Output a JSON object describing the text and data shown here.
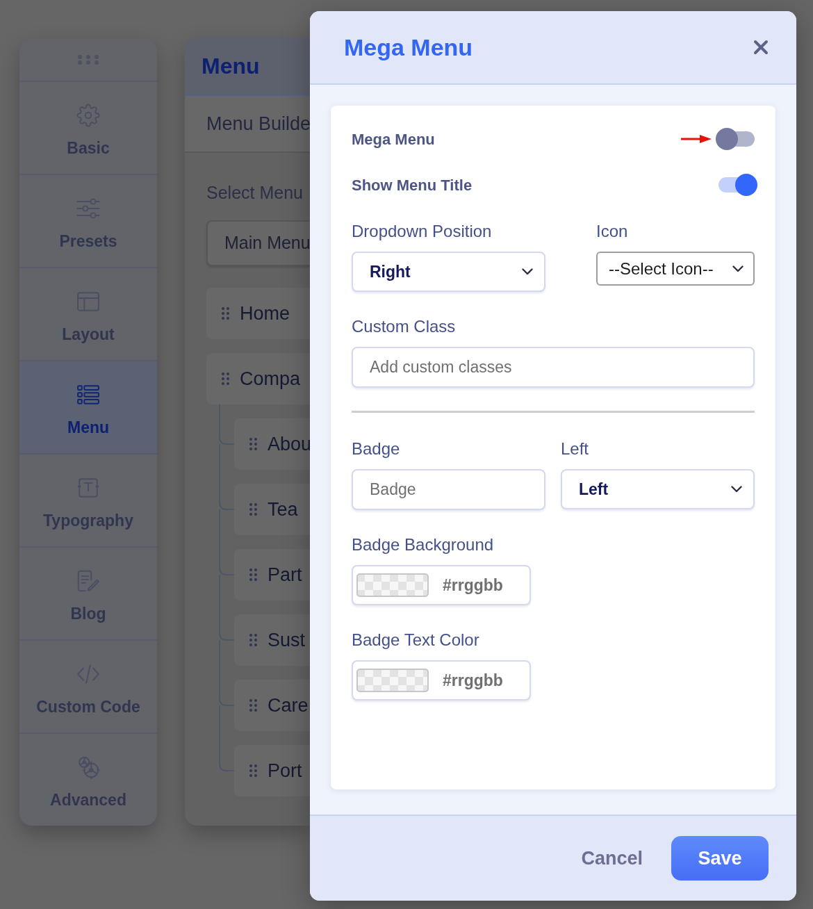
{
  "sidebar": {
    "items": [
      {
        "label": "Basic",
        "selected": false
      },
      {
        "label": "Presets",
        "selected": false
      },
      {
        "label": "Layout",
        "selected": false
      },
      {
        "label": "Menu",
        "selected": true
      },
      {
        "label": "Typography",
        "selected": false
      },
      {
        "label": "Blog",
        "selected": false
      },
      {
        "label": "Custom Code",
        "selected": false
      },
      {
        "label": "Advanced",
        "selected": false
      }
    ]
  },
  "menu_panel": {
    "title": "Menu",
    "tab": "Menu Builde",
    "select_label": "Select Menu",
    "select_value": "Main Menu",
    "items": [
      {
        "label": "Home"
      },
      {
        "label": "Compa",
        "children": [
          {
            "label": "Abou"
          },
          {
            "label": "Tea"
          },
          {
            "label": "Part"
          },
          {
            "label": "Sust"
          },
          {
            "label": "Care"
          },
          {
            "label": "Port"
          }
        ]
      }
    ]
  },
  "modal": {
    "title": "Mega Menu",
    "toggles": [
      {
        "label": "Mega Menu",
        "on": false,
        "annotated": true
      },
      {
        "label": "Show Menu Title",
        "on": true,
        "annotated": false
      }
    ],
    "sections": [
      {
        "rows": [
          {
            "fields": [
              {
                "kind": "select",
                "label": "Dropdown Position",
                "value": "Right"
              },
              {
                "kind": "native_select",
                "label": "Icon",
                "value": "--Select Icon--"
              }
            ]
          },
          {
            "fields": [
              {
                "kind": "text",
                "label": "Custom Class",
                "placeholder": "Add custom classes"
              }
            ]
          }
        ]
      },
      {
        "rows": [
          {
            "fields": [
              {
                "kind": "text",
                "label": "Badge",
                "placeholder": "Badge"
              },
              {
                "kind": "select",
                "label": "Left",
                "value": "Left"
              }
            ]
          },
          {
            "fields": [
              {
                "kind": "color",
                "label": "Badge Background",
                "placeholder": "#rrggbb"
              }
            ]
          },
          {
            "fields": [
              {
                "kind": "color",
                "label": "Badge Text Color",
                "placeholder": "#rrggbb"
              }
            ]
          }
        ]
      }
    ],
    "buttons": [
      {
        "kind": "cancel",
        "label": "Cancel"
      },
      {
        "kind": "save",
        "label": "Save"
      }
    ]
  }
}
